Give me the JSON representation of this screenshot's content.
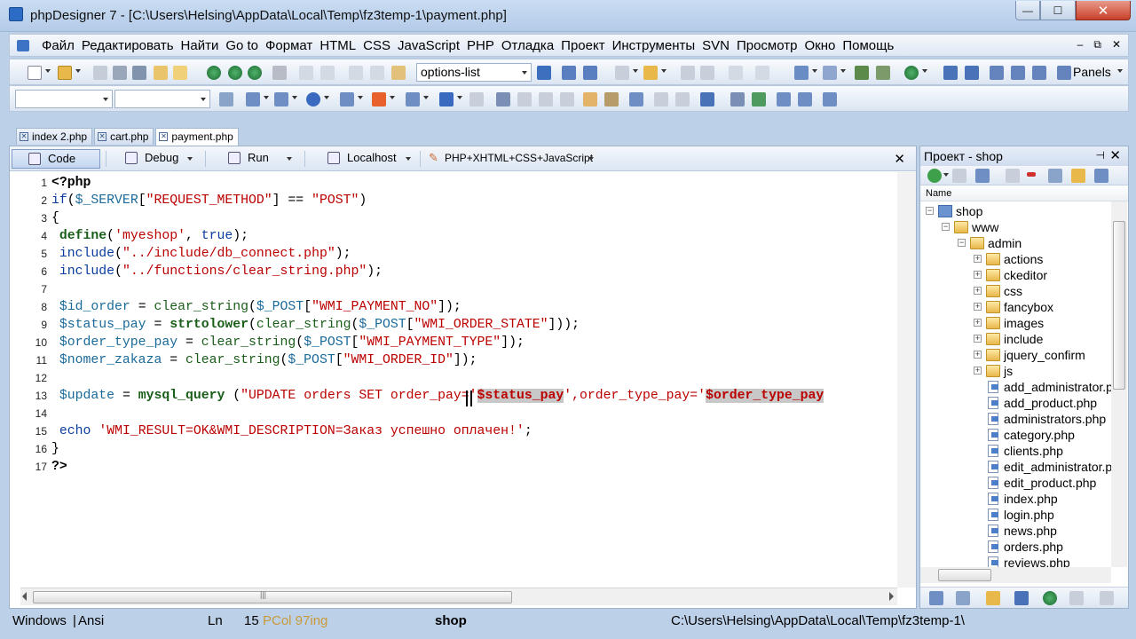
{
  "window": {
    "title": "phpDesigner 7 - [C:\\Users\\Helsing\\AppData\\Local\\Temp\\fz3temp-1\\payment.php]",
    "min_glyph": "—",
    "max_glyph": "☐",
    "close_glyph": "✕"
  },
  "menu": {
    "items": [
      "Файл",
      "Редактировать",
      "Найти",
      "Go to",
      "Формат",
      "HTML",
      "CSS",
      "JavaScript",
      "PHP",
      "Отладка",
      "Проект",
      "Инструменты",
      "SVN",
      "Просмотр",
      "Окно",
      "Помощь"
    ],
    "mdi_min": "–",
    "mdi_restore": "⧉",
    "mdi_close": "✕"
  },
  "toolbar1": {
    "combo_value": "options-list",
    "panels_label": "Panels"
  },
  "toolbar2": {
    "combo1_value": "",
    "combo2_value": ""
  },
  "file_tabs": [
    {
      "label": "index 2.php",
      "active": false
    },
    {
      "label": "cart.php",
      "active": false
    },
    {
      "label": "payment.php",
      "active": true
    }
  ],
  "editor_toolbar": {
    "code": "Code",
    "debug": "Debug",
    "run": "Run",
    "localhost": "Localhost",
    "language": "PHP+XHTML+CSS+JavaScript",
    "close": "✕"
  },
  "code_lines": [
    {
      "n": "1",
      "text": "<?php"
    },
    {
      "n": "2",
      "text": "if($_SERVER[\"REQUEST_METHOD\"] == \"POST\")"
    },
    {
      "n": "3",
      "text": "{"
    },
    {
      "n": "4",
      "text": " define('myeshop', true);"
    },
    {
      "n": "5",
      "text": " include(\"../include/db_connect.php\");"
    },
    {
      "n": "6",
      "text": " include(\"../functions/clear_string.php\");"
    },
    {
      "n": "7",
      "text": ""
    },
    {
      "n": "8",
      "text": " $id_order = clear_string($_POST[\"WMI_PAYMENT_NO\"]);"
    },
    {
      "n": "9",
      "text": " $status_pay = strtolower(clear_string($_POST[\"WMI_ORDER_STATE\"]));"
    },
    {
      "n": "10",
      "text": " $order_type_pay = clear_string($_POST[\"WMI_PAYMENT_TYPE\"]);"
    },
    {
      "n": "11",
      "text": " $nomer_zakaza = clear_string($_POST[\"WMI_ORDER_ID\"]);"
    },
    {
      "n": "12",
      "text": ""
    },
    {
      "n": "13",
      "text": " $update = mysql_query (\"UPDATE orders SET order_pay='$status_pay',order_type_pay='$order_type_pay"
    },
    {
      "n": "14",
      "text": ""
    },
    {
      "n": "15",
      "text": " echo 'WMI_RESULT=OK&WMI_DESCRIPTION=Заказ успешно оплачен!';"
    },
    {
      "n": "16",
      "text": "}"
    },
    {
      "n": "17",
      "text": "?>"
    }
  ],
  "project": {
    "title": "Проект - shop",
    "pin": "⊣",
    "close": "✕",
    "column": "Name",
    "tree": [
      {
        "label": "shop",
        "type": "project",
        "depth": 0,
        "toggle": "−"
      },
      {
        "label": "www",
        "type": "folder",
        "depth": 1,
        "toggle": "−"
      },
      {
        "label": "admin",
        "type": "folder",
        "depth": 2,
        "toggle": "−"
      },
      {
        "label": "actions",
        "type": "folder",
        "depth": 3,
        "toggle": "+"
      },
      {
        "label": "ckeditor",
        "type": "folder",
        "depth": 3,
        "toggle": "+"
      },
      {
        "label": "css",
        "type": "folder",
        "depth": 3,
        "toggle": "+"
      },
      {
        "label": "fancybox",
        "type": "folder",
        "depth": 3,
        "toggle": "+"
      },
      {
        "label": "images",
        "type": "folder",
        "depth": 3,
        "toggle": "+"
      },
      {
        "label": "include",
        "type": "folder",
        "depth": 3,
        "toggle": "+"
      },
      {
        "label": "jquery_confirm",
        "type": "folder",
        "depth": 3,
        "toggle": "+"
      },
      {
        "label": "js",
        "type": "folder",
        "depth": 3,
        "toggle": "+"
      },
      {
        "label": "add_administrator.php",
        "type": "file",
        "depth": 3,
        "toggle": ""
      },
      {
        "label": "add_product.php",
        "type": "file",
        "depth": 3,
        "toggle": ""
      },
      {
        "label": "administrators.php",
        "type": "file",
        "depth": 3,
        "toggle": ""
      },
      {
        "label": "category.php",
        "type": "file",
        "depth": 3,
        "toggle": ""
      },
      {
        "label": "clients.php",
        "type": "file",
        "depth": 3,
        "toggle": ""
      },
      {
        "label": "edit_administrator.php",
        "type": "file",
        "depth": 3,
        "toggle": ""
      },
      {
        "label": "edit_product.php",
        "type": "file",
        "depth": 3,
        "toggle": ""
      },
      {
        "label": "index.php",
        "type": "file",
        "depth": 3,
        "toggle": ""
      },
      {
        "label": "login.php",
        "type": "file",
        "depth": 3,
        "toggle": ""
      },
      {
        "label": "news.php",
        "type": "file",
        "depth": 3,
        "toggle": ""
      },
      {
        "label": "orders.php",
        "type": "file",
        "depth": 3,
        "toggle": ""
      },
      {
        "label": "reviews.php",
        "type": "file",
        "depth": 3,
        "toggle": ""
      }
    ]
  },
  "status": {
    "line_ending": "Windows",
    "encoding": "Ansi",
    "ln_label": "Ln",
    "ln_value": "15",
    "col_overlay": "PCol 97ing",
    "project": "shop",
    "path": "C:\\Users\\Helsing\\AppData\\Local\\Temp\\fz3temp-1\\"
  },
  "colors": {
    "keyword": "#0a3d9e",
    "string": "#bb0000",
    "variable": "#1a6a9a",
    "function": "#1a5e1a",
    "highlight_bg": "#c8c8c8",
    "chrome": "#bcd0e8"
  }
}
